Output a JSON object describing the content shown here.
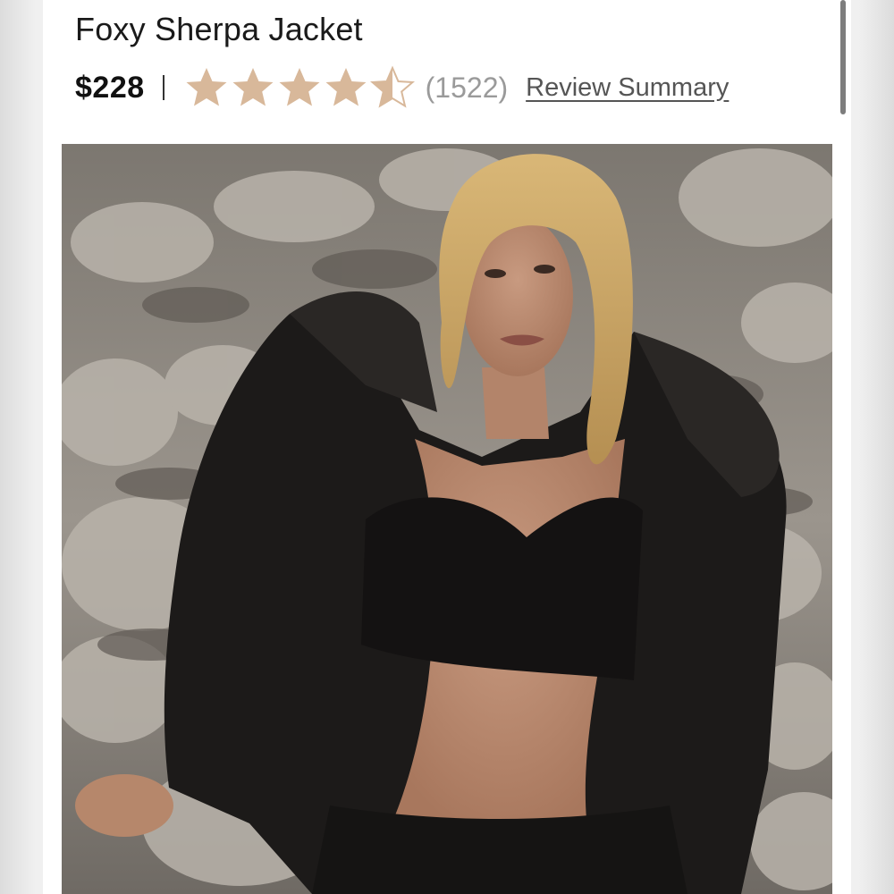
{
  "product": {
    "title": "Foxy Sherpa Jacket",
    "price": "$228",
    "rating": 4.5,
    "rating_max": 5,
    "review_count": "(1522)",
    "review_link": "Review Summary"
  },
  "colors": {
    "star": "#d8b89a",
    "text": "#1a1a1a",
    "muted": "#9a9a9a"
  },
  "icons": {
    "rating_star": "star-icon"
  }
}
